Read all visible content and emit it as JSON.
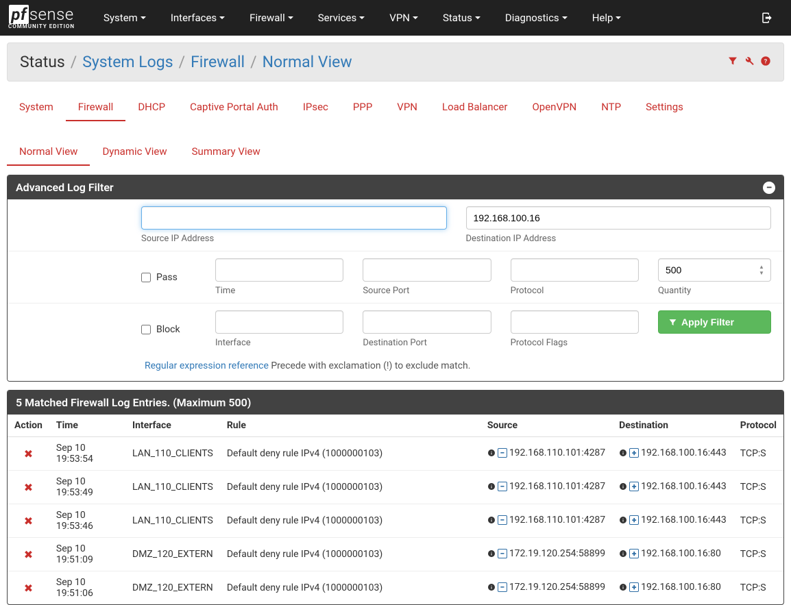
{
  "brand": {
    "pf": "pf",
    "sense": "sense",
    "edition": "COMMUNITY EDITION"
  },
  "nav": {
    "items": [
      "System",
      "Interfaces",
      "Firewall",
      "Services",
      "VPN",
      "Status",
      "Diagnostics",
      "Help"
    ]
  },
  "breadcrumb": {
    "root": "Status",
    "parts": [
      "System Logs",
      "Firewall",
      "Normal View"
    ]
  },
  "primary_tabs": {
    "items": [
      "System",
      "Firewall",
      "DHCP",
      "Captive Portal Auth",
      "IPsec",
      "PPP",
      "VPN",
      "Load Balancer",
      "OpenVPN",
      "NTP",
      "Settings"
    ],
    "active_index": 1
  },
  "secondary_tabs": {
    "items": [
      "Normal View",
      "Dynamic View",
      "Summary View"
    ],
    "active_index": 0
  },
  "filter": {
    "title": "Advanced Log Filter",
    "source_ip": {
      "value": "",
      "label": "Source IP Address"
    },
    "dest_ip": {
      "value": "192.168.100.16",
      "label": "Destination IP Address"
    },
    "pass_label": "Pass",
    "block_label": "Block",
    "time_label": "Time",
    "source_port_label": "Source Port",
    "protocol_label": "Protocol",
    "quantity_label": "Quantity",
    "quantity_value": "500",
    "interface_label": "Interface",
    "dest_port_label": "Destination Port",
    "protocol_flags_label": "Protocol Flags",
    "apply_label": "Apply Filter",
    "regex_link": "Regular expression reference",
    "regex_tail": " Precede with exclamation (!) to exclude match."
  },
  "log": {
    "title": "5 Matched Firewall Log Entries. (Maximum 500)",
    "columns": [
      "Action",
      "Time",
      "Interface",
      "Rule",
      "Source",
      "Destination",
      "Protocol"
    ],
    "rows": [
      {
        "time": "Sep 10 19:53:54",
        "iface": "LAN_110_CLIENTS",
        "rule": "Default deny rule IPv4 (1000000103)",
        "src": "192.168.110.101:4287",
        "dst": "192.168.100.16:443",
        "proto": "TCP:S"
      },
      {
        "time": "Sep 10 19:53:49",
        "iface": "LAN_110_CLIENTS",
        "rule": "Default deny rule IPv4 (1000000103)",
        "src": "192.168.110.101:4287",
        "dst": "192.168.100.16:443",
        "proto": "TCP:S"
      },
      {
        "time": "Sep 10 19:53:46",
        "iface": "LAN_110_CLIENTS",
        "rule": "Default deny rule IPv4 (1000000103)",
        "src": "192.168.110.101:4287",
        "dst": "192.168.100.16:443",
        "proto": "TCP:S"
      },
      {
        "time": "Sep 10 19:51:09",
        "iface": "DMZ_120_EXTERN",
        "rule": "Default deny rule IPv4 (1000000103)",
        "src": "172.19.120.254:58899",
        "dst": "192.168.100.16:80",
        "proto": "TCP:S"
      },
      {
        "time": "Sep 10 19:51:06",
        "iface": "DMZ_120_EXTERN",
        "rule": "Default deny rule IPv4 (1000000103)",
        "src": "172.19.120.254:58899",
        "dst": "192.168.100.16:80",
        "proto": "TCP:S"
      }
    ]
  }
}
